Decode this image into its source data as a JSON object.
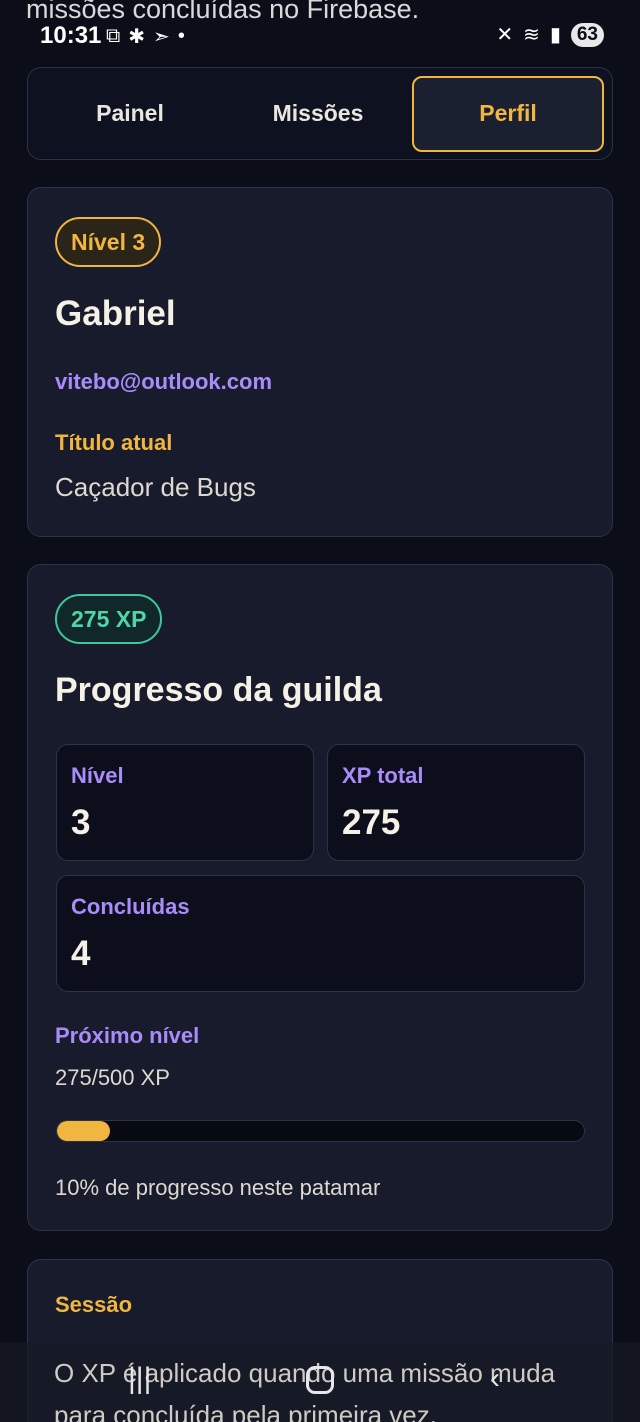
{
  "top_overlay_text": "missões concluídas no Firebase.",
  "status_bar": {
    "time": "10:31",
    "left_icons": [
      "screenshot-icon",
      "bug-icon",
      "send-icon",
      "dot-icon"
    ],
    "right_icons": [
      "mute-icon",
      "wifi-icon",
      "signal-icon"
    ],
    "battery": "63"
  },
  "tabs": [
    {
      "label": "Painel",
      "active": false
    },
    {
      "label": "Missões",
      "active": false
    },
    {
      "label": "Perfil",
      "active": true
    }
  ],
  "profile": {
    "level_badge": "Nível 3",
    "name": "Gabriel",
    "email": "vitebo@outlook.com",
    "title_label": "Título atual",
    "title_value": "Caçador de Bugs"
  },
  "progress": {
    "xp_badge": "275 XP",
    "heading": "Progresso da guilda",
    "stats": {
      "level_label": "Nível",
      "level_value": "3",
      "xp_label": "XP total",
      "xp_value": "275",
      "done_label": "Concluídas",
      "done_value": "4"
    },
    "next_label": "Próximo nível",
    "next_value": "275/500 XP",
    "bar_percent": 10,
    "percent_text": "10% de progresso neste patamar"
  },
  "session": {
    "label": "Sessão",
    "text": "O XP é aplicado quando uma missão muda para concluída pela primeira vez."
  },
  "nav": {
    "icons": [
      "recent-apps-icon",
      "home-icon",
      "back-icon"
    ]
  },
  "colors": {
    "background": "#0b0e18",
    "card": "#171b2c",
    "accent_gold": "#f0b63f",
    "accent_purple": "#a98bfa",
    "accent_green": "#4fd6a6"
  }
}
